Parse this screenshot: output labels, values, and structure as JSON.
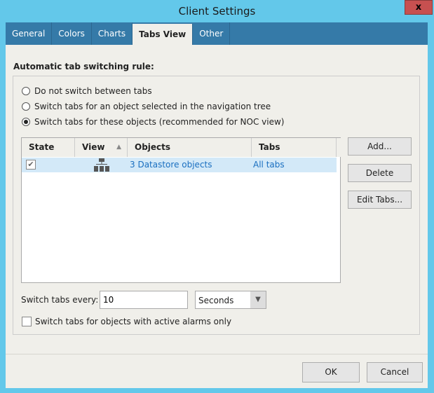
{
  "window": {
    "title": "Client Settings",
    "close": "x"
  },
  "tabs": [
    "General",
    "Colors",
    "Charts",
    "Tabs View",
    "Other"
  ],
  "active_tab": "Tabs View",
  "rule_label": "Automatic tab switching rule:",
  "options": [
    {
      "label": "Do not switch between tabs",
      "selected": false
    },
    {
      "label": "Switch tabs for an object selected in the navigation tree",
      "selected": false
    },
    {
      "label": "Switch tabs for these objects (recommended for NOC view)",
      "selected": true
    }
  ],
  "table": {
    "columns": [
      "State",
      "View",
      "Objects",
      "Tabs"
    ],
    "sort_column": "View",
    "rows": [
      {
        "state": true,
        "view_icon": "network-tree-icon",
        "objects": "3 Datastore objects",
        "tabs": "All tabs"
      }
    ]
  },
  "buttons": {
    "add": "Add...",
    "delete": "Delete",
    "edit": "Edit Tabs...",
    "ok": "OK",
    "cancel": "Cancel"
  },
  "interval": {
    "label": "Switch tabs every:",
    "value": "10",
    "unit": "Seconds"
  },
  "alarms_only": {
    "label": "Switch tabs for objects with active alarms only",
    "checked": false
  }
}
